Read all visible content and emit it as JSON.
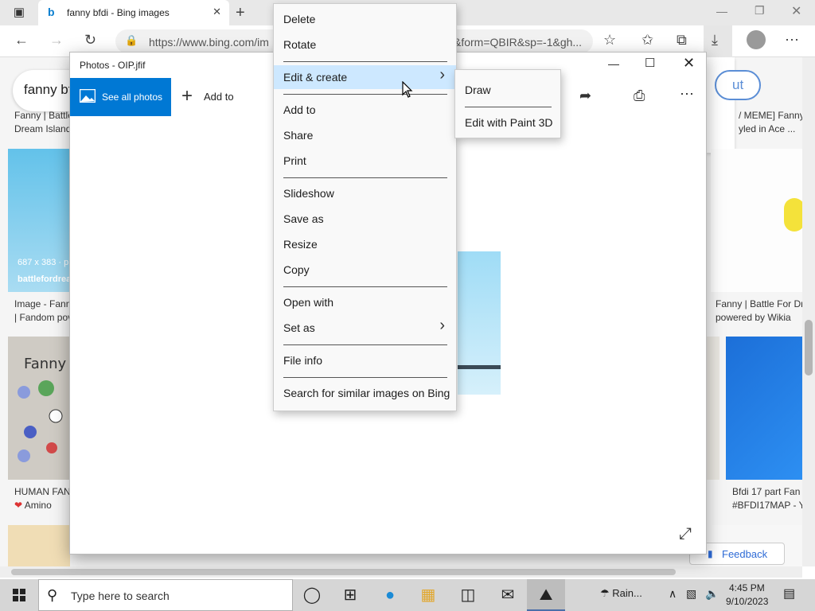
{
  "browser": {
    "tab_title": "fanny bfdi - Bing images",
    "tab_favicon": "b",
    "url": "https://www.bing.com/im",
    "url_tail": "&form=QBIR&sp=-1&gh..."
  },
  "bing": {
    "search_text": "fanny bf",
    "filter_label": "ut",
    "feedback_label": "Feedback",
    "results": [
      {
        "caption_lines": [
          "Fanny | Battle",
          "Dream Island"
        ]
      },
      {
        "caption_lines": [
          "Image - Fann",
          "| Fandom pov"
        ],
        "meta": "687 x 383 · p",
        "source": "battlefordrea"
      },
      {
        "caption_lines": [
          "HUMAN FAN",
          "Amino"
        ]
      },
      {
        "caption_lines": [
          "/ MEME] Fanny",
          "yled in Ace ..."
        ]
      },
      {
        "caption_lines": [
          "Fanny | Battle For Dr",
          "powered by Wikia"
        ]
      },
      {
        "caption_lines": [
          "Bfdi 17 part Fan",
          "#BFDI17MAP - Y"
        ]
      }
    ]
  },
  "photos": {
    "title": "Photos - OIP.jfif",
    "see_all_label": "See all photos",
    "add_to_label": "Add to"
  },
  "context_menu": {
    "groups": [
      [
        "Delete",
        "Rotate"
      ],
      [
        "Edit & create"
      ],
      [
        "Add to",
        "Share",
        "Print"
      ],
      [
        "Slideshow",
        "Save as",
        "Resize",
        "Copy"
      ],
      [
        "Open with",
        "Set as"
      ],
      [
        "File info"
      ],
      [
        "Search for similar images on Bing"
      ]
    ],
    "highlighted": "Edit & create",
    "submenu_items": [
      "Edit & create",
      "Set as"
    ]
  },
  "submenu": {
    "items": [
      "Draw",
      "Edit with Paint 3D"
    ]
  },
  "taskbar": {
    "search_placeholder": "Type here to search",
    "weather": "Rain...",
    "time": "4:45 PM",
    "date": "9/10/2023"
  }
}
